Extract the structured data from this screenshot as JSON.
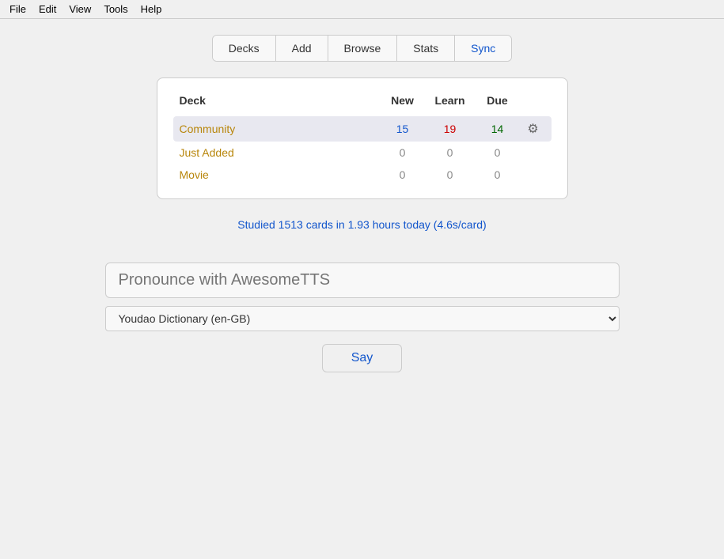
{
  "menubar": {
    "items": [
      {
        "label": "File",
        "name": "menu-file"
      },
      {
        "label": "Edit",
        "name": "menu-edit"
      },
      {
        "label": "View",
        "name": "menu-view"
      },
      {
        "label": "Tools",
        "name": "menu-tools"
      },
      {
        "label": "Help",
        "name": "menu-help"
      }
    ]
  },
  "tabs": [
    {
      "label": "Decks",
      "name": "tab-decks",
      "active": false
    },
    {
      "label": "Add",
      "name": "tab-add",
      "active": false
    },
    {
      "label": "Browse",
      "name": "tab-browse",
      "active": false
    },
    {
      "label": "Stats",
      "name": "tab-stats",
      "active": false
    },
    {
      "label": "Sync",
      "name": "tab-sync",
      "active": true
    }
  ],
  "deck_table": {
    "headers": {
      "deck": "Deck",
      "new": "New",
      "learn": "Learn",
      "due": "Due"
    },
    "rows": [
      {
        "name": "Community",
        "new": "15",
        "learn": "19",
        "due": "14",
        "has_gear": true,
        "selected": true
      },
      {
        "name": "Just Added",
        "new": "0",
        "learn": "0",
        "due": "0",
        "has_gear": false,
        "selected": false
      },
      {
        "name": "Movie",
        "new": "0",
        "learn": "0",
        "due": "0",
        "has_gear": false,
        "selected": false
      }
    ]
  },
  "stats_text": "Studied 1513 cards in 1.93 hours today (4.6s/card)",
  "tts": {
    "input_placeholder": "Pronounce with AwesomeTTS",
    "select_value": "Youdao Dictionary (en-GB)",
    "select_options": [
      "Youdao Dictionary (en-GB)"
    ],
    "say_button_label": "Say"
  },
  "colors": {
    "new": "#1155cc",
    "learn": "#cc0000",
    "due": "#006600",
    "zero": "#888888",
    "deck_name_yellow": "#b8860b",
    "sync_blue": "#1155cc",
    "stats_blue": "#1155cc"
  }
}
